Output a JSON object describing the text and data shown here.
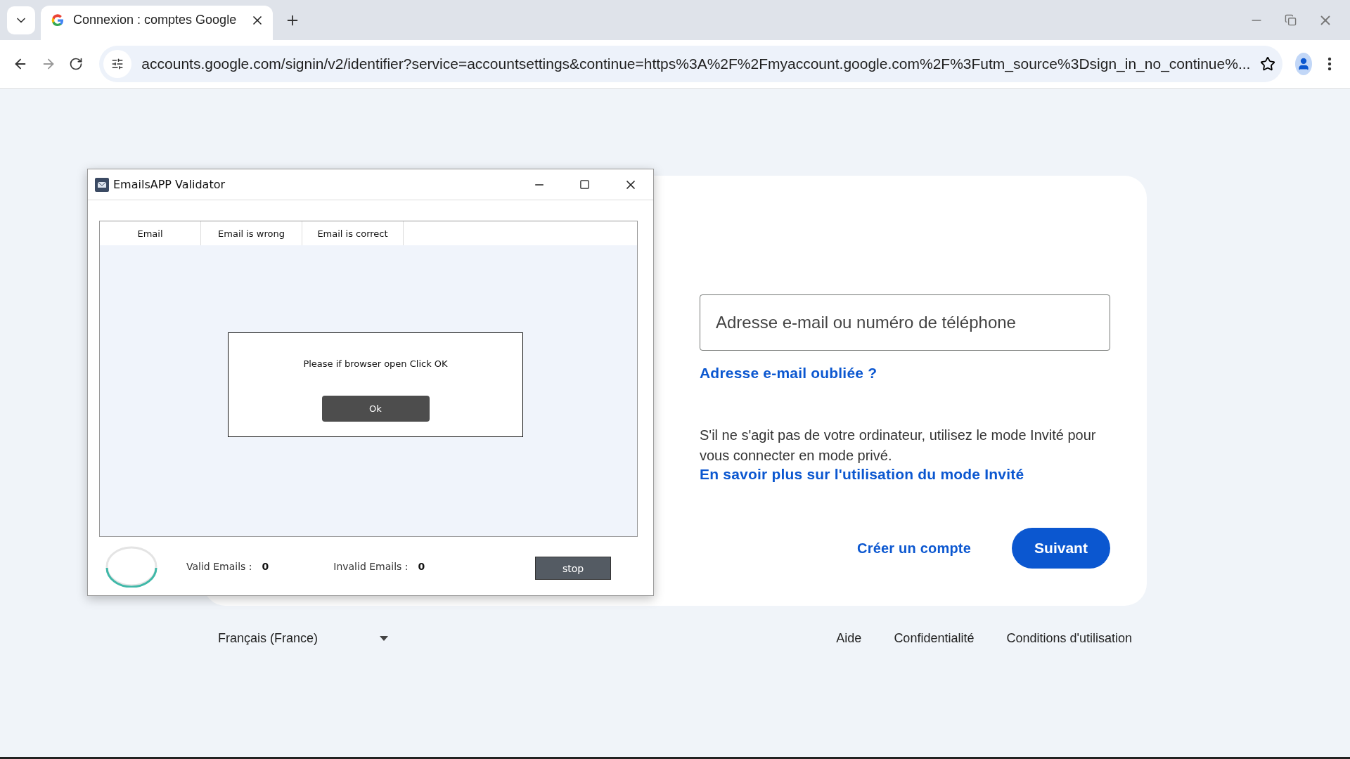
{
  "browser": {
    "tabs": [
      {
        "title": "Connexion : comptes Google",
        "selected": true
      }
    ],
    "url": "accounts.google.com/signin/v2/identifier?service=accountsettings&continue=https%3A%2F%2Fmyaccount.google.com%2F%3Futm_source%3Dsign_in_no_continue%..."
  },
  "signin": {
    "email_field": {
      "placeholder": "Adresse e-mail ou numéro de téléphone"
    },
    "forgot_link": "Adresse e-mail oubliée ?",
    "guest_text": "S'il ne s'agit pas de votre ordinateur, utilisez le mode Invité pour vous connecter en mode privé.",
    "guest_link": "En savoir plus sur l'utilisation du mode Invité",
    "create_account": "Créer un compte",
    "next_button": "Suivant"
  },
  "footer": {
    "language": "Français (France)",
    "links": [
      "Aide",
      "Confidentialité",
      "Conditions d'utilisation"
    ]
  },
  "app_window": {
    "title": "EmailsAPP Validator",
    "columns": [
      "Email",
      "Email is wrong",
      "Email is correct"
    ],
    "dialog": {
      "message": "Please if browser open Click OK",
      "button": "Ok"
    },
    "stats": [
      {
        "label": "Valid Emails :",
        "value": "0"
      },
      {
        "label": "Invalid Emails :",
        "value": "0"
      }
    ],
    "stop_button": "stop"
  }
}
